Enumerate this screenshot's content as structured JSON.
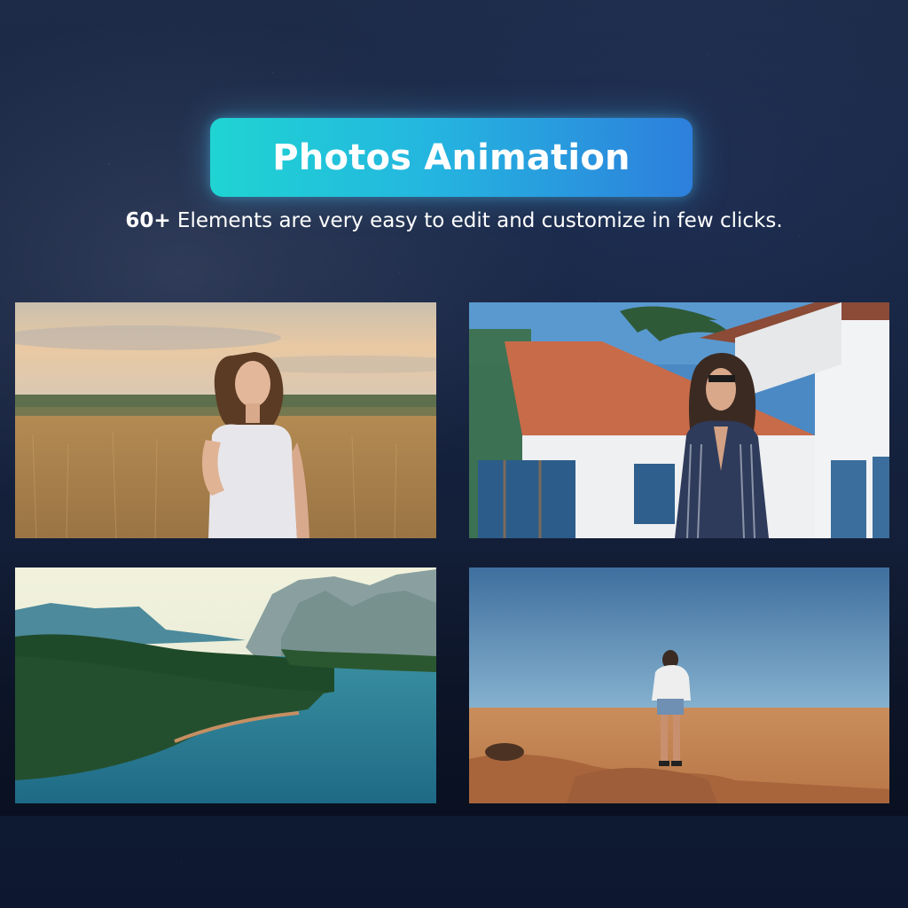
{
  "header": {
    "title": "Photos Animation",
    "subtitle_highlight": "60+",
    "subtitle_rest": " Elements are very easy to edit and customize in few clicks."
  },
  "photos": [
    {
      "name": "woman in wheat field at sunset"
    },
    {
      "name": "woman in striped suit by white house"
    },
    {
      "name": "aerial lake with forest and cliffs"
    },
    {
      "name": "woman standing in desert"
    }
  ],
  "colors": {
    "badge_start": "#1fd4d2",
    "badge_end": "#2d7fdc",
    "background": "#16233f"
  }
}
